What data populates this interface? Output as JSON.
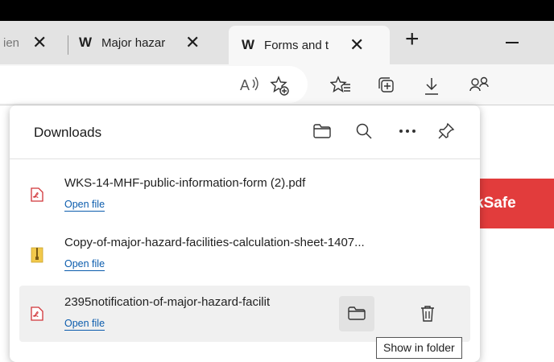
{
  "tabs": [
    {
      "label": "ien",
      "active": false
    },
    {
      "label": "Major hazar",
      "active": false,
      "favicon": "W"
    },
    {
      "label": "Forms and t",
      "active": true,
      "favicon": "W"
    }
  ],
  "toolbar_icons": [
    "read-aloud-icon",
    "add-favorite-icon",
    "favorites-icon",
    "collections-icon",
    "download-icon",
    "profile-icon"
  ],
  "page": {
    "banner_text": "kSafe"
  },
  "downloads": {
    "title": "Downloads",
    "items": [
      {
        "name": "WKS-14-MHF-public-information-form (2).pdf",
        "action": "Open file",
        "type": "pdf"
      },
      {
        "name": "Copy-of-major-hazard-facilities-calculation-sheet-1407...",
        "action": "Open file",
        "type": "zip"
      },
      {
        "name": "2395notification-of-major-hazard-facilit",
        "action": "Open file",
        "type": "pdf"
      }
    ],
    "tooltip": "Show in folder"
  }
}
